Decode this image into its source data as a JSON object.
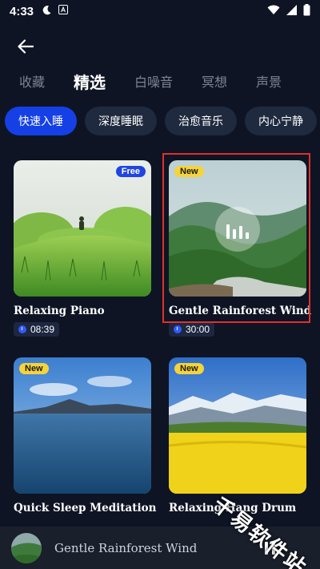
{
  "status_bar": {
    "time": "4:33",
    "icons": [
      "moon-icon",
      "a-icon",
      "wifi-icon",
      "signal-icon",
      "battery-icon"
    ]
  },
  "tabs": [
    "收藏",
    "精选",
    "白噪音",
    "冥想",
    "声景"
  ],
  "active_tab": "精选",
  "chips": [
    "快速入睡",
    "深度睡眠",
    "治愈音乐",
    "内心宁静"
  ],
  "active_chip": "快速入睡",
  "cards": [
    {
      "title": "Relaxing Piano",
      "badge": "Free",
      "duration": "08:39"
    },
    {
      "title": "Gentle Rainforest Wind",
      "badge": "New",
      "duration": "30:00"
    },
    {
      "title": "Quick Sleep Meditation",
      "badge": "New",
      "duration": ""
    },
    {
      "title": "Relaxing Hang Drum",
      "badge": "New",
      "duration": ""
    }
  ],
  "player": {
    "title": "Gentle Rainforest Wind",
    "state": "playing"
  },
  "watermark": "千易软件站",
  "colors": {
    "background": "#0e1424",
    "accent": "#1540e6",
    "badge_new": "#f5d33a",
    "highlight": "#e0302c"
  }
}
